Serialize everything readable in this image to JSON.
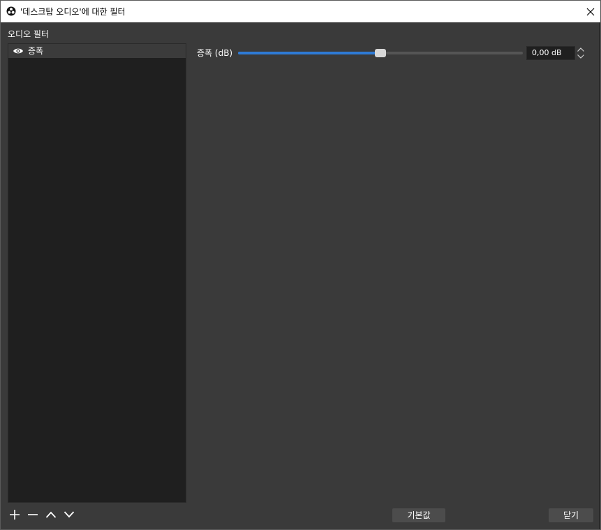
{
  "window": {
    "title": "'데스크탑 오디오'에 대한 필터"
  },
  "filters_panel": {
    "label": "오디오 필터",
    "items": [
      {
        "name": "증폭",
        "visible": true
      }
    ]
  },
  "properties": {
    "gain_label": "증폭 (dB)",
    "gain_value_text": "0,00 dB",
    "gain_slider_fraction": 0.5
  },
  "buttons": {
    "defaults": "기본값",
    "close": "닫기"
  },
  "colors": {
    "background": "#3a3a3a",
    "list_background": "#1f1f1f",
    "accent": "#2e7bd6"
  }
}
